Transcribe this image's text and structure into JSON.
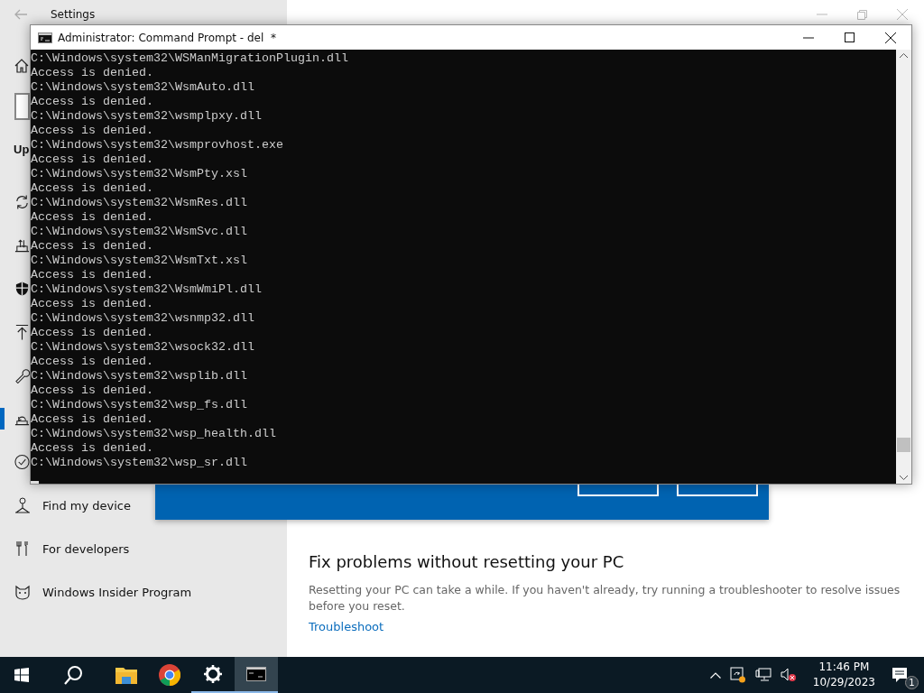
{
  "settings_window": {
    "title": "Settings",
    "sidebar": {
      "heading": "Up",
      "items": [
        {
          "kind": "sync",
          "selected": false
        },
        {
          "kind": "delivery",
          "selected": false
        },
        {
          "kind": "shield",
          "selected": false
        },
        {
          "kind": "backup",
          "selected": false
        },
        {
          "kind": "wrench",
          "selected": false
        },
        {
          "kind": "recovery",
          "selected": true
        },
        {
          "kind": "activation",
          "selected": false
        },
        {
          "kind": "find",
          "label": "Find my device",
          "selected": false
        },
        {
          "kind": "developers",
          "label": "For developers",
          "selected": false
        },
        {
          "kind": "insider",
          "label": "Windows Insider Program",
          "selected": false
        }
      ]
    },
    "section": {
      "heading": "Fix problems without resetting your PC",
      "text": "Resetting your PC can take a while. If you haven't already, try running a troubleshooter to resolve issues before you reset.",
      "link": "Troubleshoot"
    }
  },
  "console_window": {
    "title": "Administrator: Command Prompt - del  *",
    "lines": [
      "C:\\Windows\\system32\\WSManMigrationPlugin.dll",
      "Access is denied.",
      "C:\\Windows\\system32\\WsmAuto.dll",
      "Access is denied.",
      "C:\\Windows\\system32\\wsmplpxy.dll",
      "Access is denied.",
      "C:\\Windows\\system32\\wsmprovhost.exe",
      "Access is denied.",
      "C:\\Windows\\system32\\WsmPty.xsl",
      "Access is denied.",
      "C:\\Windows\\system32\\WsmRes.dll",
      "Access is denied.",
      "C:\\Windows\\system32\\WsmSvc.dll",
      "Access is denied.",
      "C:\\Windows\\system32\\WsmTxt.xsl",
      "Access is denied.",
      "C:\\Windows\\system32\\WsmWmiPl.dll",
      "Access is denied.",
      "C:\\Windows\\system32\\wsnmp32.dll",
      "Access is denied.",
      "C:\\Windows\\system32\\wsock32.dll",
      "Access is denied.",
      "C:\\Windows\\system32\\wsplib.dll",
      "Access is denied.",
      "C:\\Windows\\system32\\wsp_fs.dll",
      "Access is denied.",
      "C:\\Windows\\system32\\wsp_health.dll",
      "Access is denied.",
      "C:\\Windows\\system32\\wsp_sr.dll"
    ]
  },
  "taskbar": {
    "apps": [
      {
        "kind": "explorer",
        "active": false,
        "running": false
      },
      {
        "kind": "browser",
        "active": false,
        "running": false
      },
      {
        "kind": "settings",
        "active": false,
        "running": true
      },
      {
        "kind": "console",
        "active": true,
        "running": true
      }
    ],
    "time": "11:46 PM",
    "date": "10/29/2023",
    "notification_count": "1"
  }
}
